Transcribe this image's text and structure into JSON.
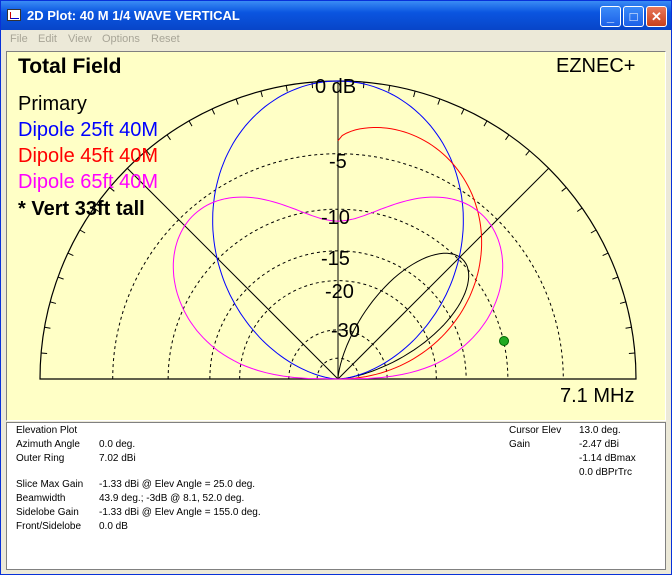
{
  "window": {
    "title": "2D Plot: 40 M 1/4 WAVE VERTICAL",
    "minimize": "_",
    "maximize": "□",
    "close": "✕"
  },
  "menu": [
    "File",
    "Edit",
    "View",
    "Options",
    "Reset"
  ],
  "plot": {
    "title": "Total Field",
    "brand": "EZNEC+",
    "frequency": "7.1 MHz",
    "ring_labels": [
      "0 dB",
      "-5",
      "-10",
      "-15",
      "-20",
      "-30"
    ],
    "legend": [
      {
        "label": "Primary",
        "color": "#000000"
      },
      {
        "label": "Dipole 25ft 40M",
        "color": "#0000ff"
      },
      {
        "label": "Dipole 45ft 40M",
        "color": "#ff0000"
      },
      {
        "label": "Dipole 65ft 40M",
        "color": "#ff00ff"
      },
      {
        "label": "* Vert 33ft tall",
        "color": "#000000"
      }
    ],
    "cursor_color": "#22aa22"
  },
  "info": {
    "plot_type": "Elevation Plot",
    "azimuth_label": "Azimuth Angle",
    "azimuth_value": "0.0 deg.",
    "outer_ring_label": "Outer Ring",
    "outer_ring_value": "7.02 dBi",
    "slice_label": "Slice Max Gain",
    "slice_value": "-1.33 dBi @ Elev Angle = 25.0 deg.",
    "beamwidth_label": "Beamwidth",
    "beamwidth_value": "43.9 deg.; -3dB @ 8.1, 52.0 deg.",
    "sidelobe_label": "Sidelobe Gain",
    "sidelobe_value": "-1.33 dBi @ Elev Angle = 155.0 deg.",
    "fs_label": "Front/Sidelobe",
    "fs_value": "0.0 dB",
    "cursor_elev_label": "Cursor Elev",
    "cursor_elev_value": "13.0 deg.",
    "gain_label": "Gain",
    "gain_dbi": "-2.47 dBi",
    "gain_dbmax": "-1.14 dBmax",
    "gain_dbprtrc": "0.0 dBPrTrc"
  }
}
